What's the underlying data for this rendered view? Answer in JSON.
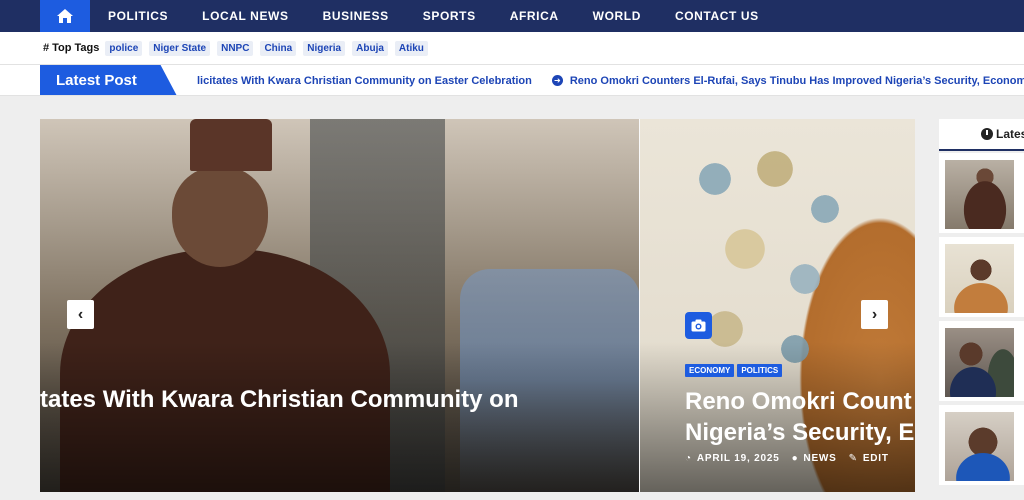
{
  "nav": {
    "items": [
      "POLITICS",
      "LOCAL NEWS",
      "BUSINESS",
      "SPORTS",
      "AFRICA",
      "WORLD",
      "CONTACT US"
    ]
  },
  "tags": {
    "title": "Top Tags",
    "items": [
      "police",
      "Niger State",
      "NNPC",
      "China",
      "Nigeria",
      "Abuja",
      "Atiku"
    ]
  },
  "ticker": {
    "label": "Latest Post",
    "items": [
      "licitates With Kwara Christian Community on Easter Celebration",
      "Reno Omokri Counters El-Rufai, Says Tinubu Has Improved Nigeria’s Security, Econom"
    ]
  },
  "slider": {
    "slide1_title": "tates With Kwara Christian Community on",
    "slide2_title_line1": "Reno Omokri Count",
    "slide2_title_line2": "Nigeria’s Security, E",
    "categories": [
      "ECONOMY",
      "POLITICS"
    ],
    "date": "APRIL 19, 2025",
    "author": "NEWS",
    "edit": "EDIT"
  },
  "sidebar": {
    "tab_label": "Lates"
  },
  "colors": {
    "nav_bg": "#1f2f63",
    "accent": "#1d5ce0",
    "link": "#1d45b6"
  }
}
